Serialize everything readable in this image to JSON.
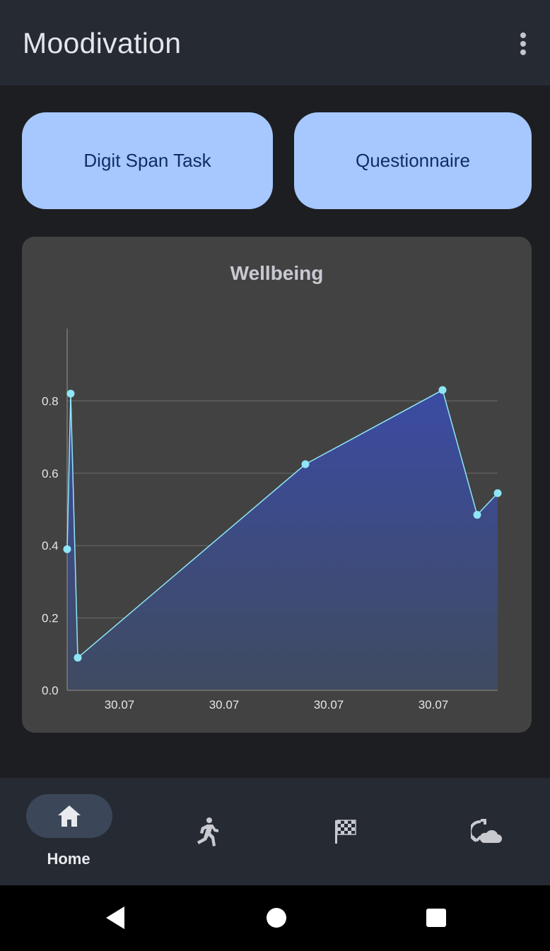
{
  "app": {
    "title": "Moodivation"
  },
  "icons": {
    "overflow": "more-vert-icon"
  },
  "actions": {
    "digit_span": "Digit Span Task",
    "questionnaire": "Questionnaire"
  },
  "chart_data": {
    "type": "area",
    "title": "Wellbeing",
    "x": [
      "",
      "",
      "",
      "",
      "",
      "",
      ""
    ],
    "xticks": [
      "30.07",
      "30.07",
      "30.07",
      "30.07"
    ],
    "yticks": [
      "0.0",
      "0.2",
      "0.4",
      "0.6",
      "0.8"
    ],
    "series": [
      {
        "values": [
          0.39,
          0.82,
          0.09,
          0.625,
          0.83,
          0.485,
          0.545
        ]
      }
    ],
    "ylim": [
      0,
      1.0
    ],
    "grid": true,
    "line_color": "#8ee6f7",
    "fill_top": "#3b4ba3",
    "fill_bottom": "#3f4b60"
  },
  "nav": {
    "items": [
      {
        "label": "Home",
        "icon": "home-icon",
        "active": true
      },
      {
        "label": "",
        "icon": "running-icon",
        "active": false
      },
      {
        "label": "",
        "icon": "checkered-flag-icon",
        "active": false
      },
      {
        "label": "",
        "icon": "cloud-sync-icon",
        "active": false
      }
    ]
  },
  "system_nav": [
    "back-icon",
    "home-circle-icon",
    "recents-square-icon"
  ]
}
